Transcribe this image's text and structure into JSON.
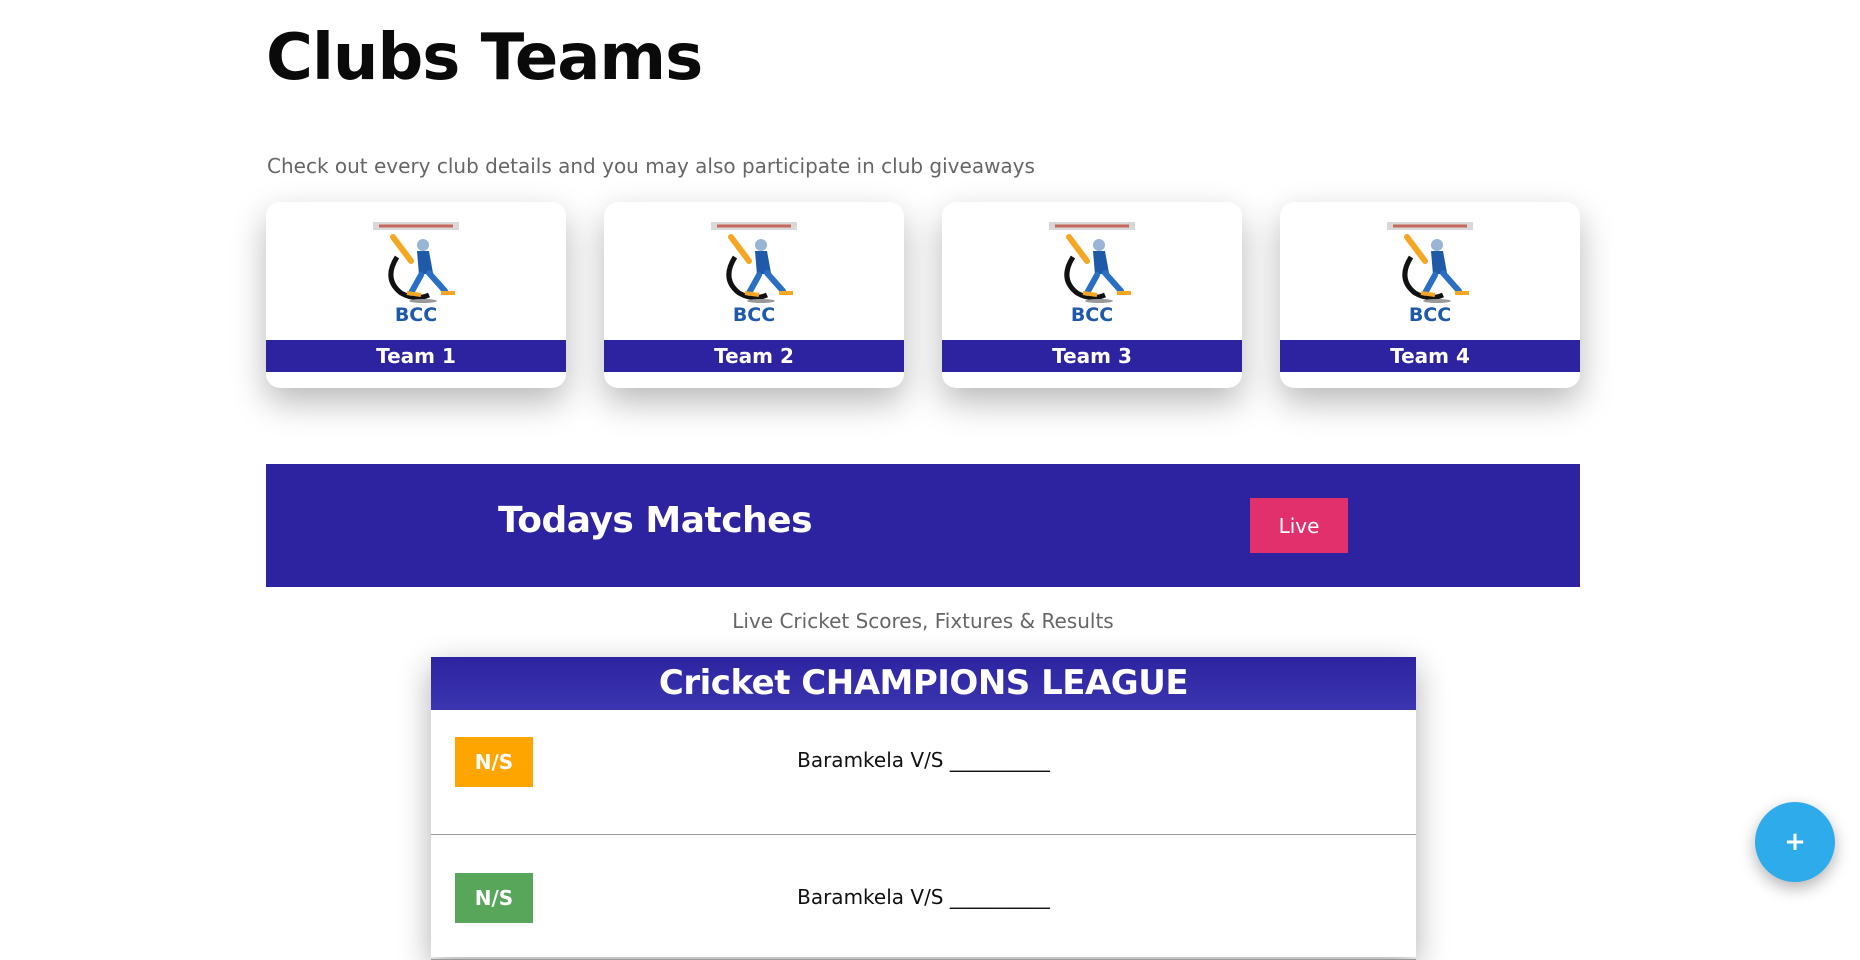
{
  "page": {
    "title": "Clubs Teams",
    "subtitle": "Check out every club details and you may also participate in club giveaways"
  },
  "teams": [
    {
      "name": "Team 1",
      "logo_text": "BCC"
    },
    {
      "name": "Team 2",
      "logo_text": "BCC"
    },
    {
      "name": "Team 3",
      "logo_text": "BCC"
    },
    {
      "name": "Team 4",
      "logo_text": "BCC"
    }
  ],
  "matches": {
    "title": "Todays Matches",
    "live_label": "Live",
    "caption": "Live Cricket Scores, Fixtures & Results"
  },
  "league": {
    "title": "Cricket CHAMPIONS LEAGUE",
    "rows": [
      {
        "status": "N/S",
        "status_color": "#ffa500",
        "fixture": "Baramkela V/S __________"
      },
      {
        "status": "N/S",
        "status_color": "#57a65a",
        "fixture": "Baramkela V/S __________"
      }
    ]
  },
  "fab": {
    "label": "+"
  },
  "colors": {
    "brand": "#2d23a0",
    "live": "#e1306c",
    "fab": "#2eabea",
    "ns_orange": "#ffa500",
    "ns_green": "#57a65a"
  },
  "icons": [
    "cricket-batsman-logo-icon"
  ]
}
